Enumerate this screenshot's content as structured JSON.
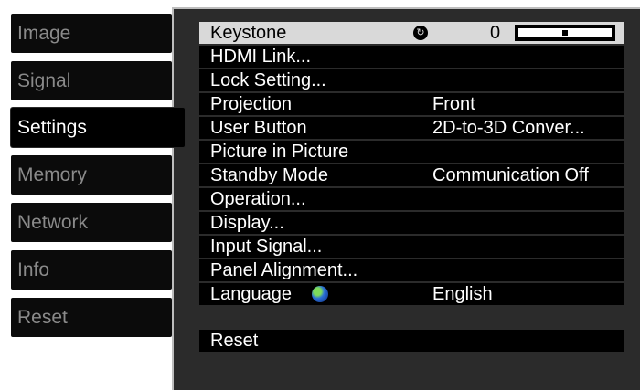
{
  "sidebar": {
    "tabs": [
      {
        "label": "Image"
      },
      {
        "label": "Signal"
      },
      {
        "label": "Settings",
        "active": true
      },
      {
        "label": "Memory"
      },
      {
        "label": "Network"
      },
      {
        "label": "Info"
      },
      {
        "label": "Reset"
      }
    ]
  },
  "settings": {
    "keystone": {
      "label": "Keystone",
      "value": "0",
      "icon": "rotate-icon",
      "slider_fraction": 0.5
    },
    "items": [
      {
        "label": "HDMI Link...",
        "value": ""
      },
      {
        "label": "Lock Setting...",
        "value": ""
      },
      {
        "label": "Projection",
        "value": "Front"
      },
      {
        "label": "User Button",
        "value": "2D-to-3D Conver..."
      },
      {
        "label": "Picture in Picture",
        "value": ""
      },
      {
        "label": "Standby Mode",
        "value": "Communication Off"
      },
      {
        "label": "Operation...",
        "value": ""
      },
      {
        "label": "Display...",
        "value": ""
      },
      {
        "label": "Input Signal...",
        "value": ""
      },
      {
        "label": "Panel Alignment...",
        "value": ""
      }
    ],
    "language": {
      "label": "Language",
      "value": "English",
      "icon": "globe-icon"
    },
    "reset_label": "Reset"
  },
  "colors": {
    "selected_row": "#d9d9d9",
    "row": "#000000",
    "panel": "#2b2b2b",
    "inactive_tab_text": "#8a8a8a"
  }
}
